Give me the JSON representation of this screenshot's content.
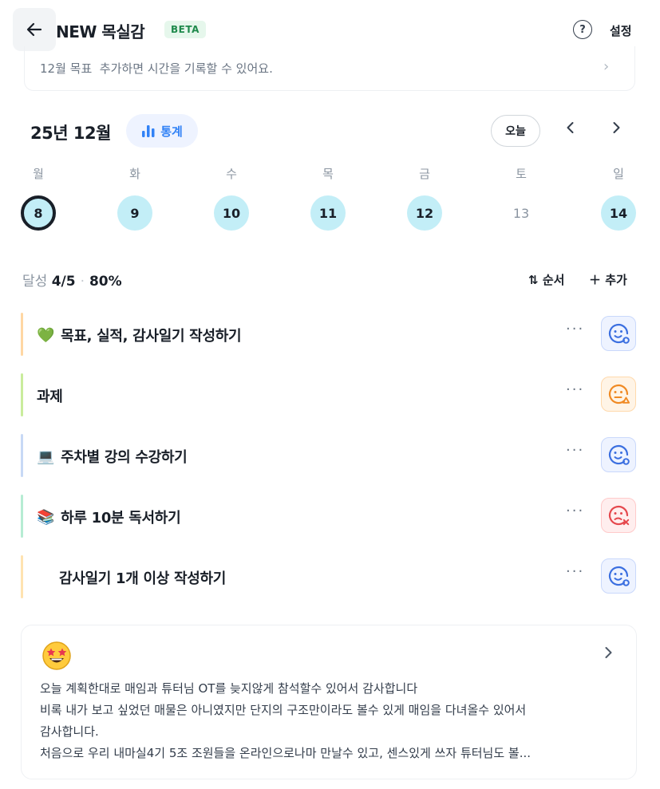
{
  "header": {
    "title": "NEW 목실감",
    "badge": "BETA",
    "help_glyph": "?",
    "settings_label": "설정"
  },
  "goal": {
    "text": "12월 목표  추가하면 시간을 기록할 수 있어요."
  },
  "calendar": {
    "month_label": "25년 12월",
    "stats_label": "통계",
    "today_label": "오늘",
    "weekdays": [
      "월",
      "화",
      "수",
      "목",
      "금",
      "토",
      "일"
    ],
    "days": [
      {
        "num": "8",
        "state": "selected"
      },
      {
        "num": "9",
        "state": "done"
      },
      {
        "num": "10",
        "state": "done"
      },
      {
        "num": "11",
        "state": "done"
      },
      {
        "num": "12",
        "state": "done"
      },
      {
        "num": "13",
        "state": "none"
      },
      {
        "num": "14",
        "state": "done"
      }
    ]
  },
  "achievement": {
    "label": "달성",
    "count": "4/5",
    "percent": "80%",
    "sort_label": "순서",
    "add_label": "추가"
  },
  "tasks": [
    {
      "emoji": "💚",
      "label": "목표, 실적, 감사일기 작성하기",
      "bar_color": "#ffd7a3",
      "status": "blue",
      "indent": false
    },
    {
      "emoji": "",
      "label": "과제",
      "bar_color": "#c9ec9c",
      "status": "orange",
      "indent": false
    },
    {
      "emoji": "💻",
      "label": "주차별 강의 수강하기",
      "bar_color": "#c7d9f5",
      "status": "blue",
      "indent": false
    },
    {
      "emoji": "📚",
      "label": "하루 10분 독서하기",
      "bar_color": "#b6ecd3",
      "status": "red",
      "indent": false
    },
    {
      "emoji": "",
      "label": "감사일기 1개 이상 작성하기",
      "bar_color": "#ffe3b0",
      "status": "blue",
      "indent": true
    }
  ],
  "diary": {
    "emoji": "🤩",
    "lines": [
      "오늘 계획한대로 매임과 튜터님 OT를 늦지않게 참석할수 있어서 감사합니다",
      "비록 내가 보고 싶었던 매물은 아니였지만 단지의 구조만이라도 볼수 있게 매임을 다녀올수 있어서",
      "감사합니다.",
      "처음으로 우리 내마실4기 5조 조원들을 온라인으로나마 만날수 있고, 센스있게 쓰자 튜터님도 볼..."
    ]
  },
  "colors": {
    "accent": "#3182f6",
    "day_done": "#c3eef7",
    "status_blue": "#3b6fe0",
    "status_orange": "#f08a24",
    "status_red": "#e5484d"
  }
}
